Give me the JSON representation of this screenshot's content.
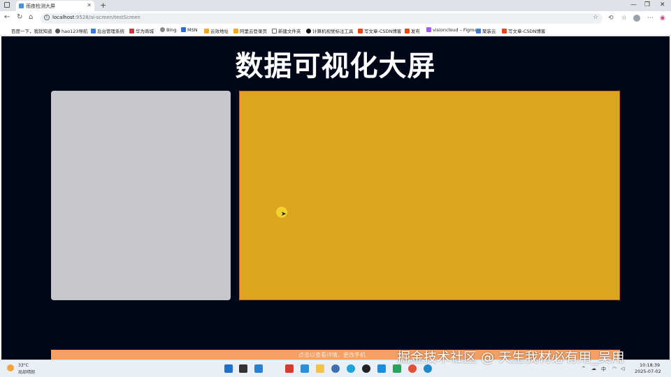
{
  "browser": {
    "tab_title": "雨夜检测大屏",
    "url_host": "localhost",
    "url_rest": ":9528/ai-screen/testScreen"
  },
  "bookmarks": [
    {
      "label": "百度一下，我就知道",
      "icon_color": "#ffffff"
    },
    {
      "label": "hao123导航",
      "icon_color": "#555555"
    },
    {
      "label": "后台管理系统",
      "icon_color": "#3b7bd8"
    },
    {
      "label": "华为商城",
      "icon_color": "#d6303b"
    },
    {
      "label": "Bing",
      "icon_color": "#888888"
    },
    {
      "label": "MSN",
      "icon_color": "#2f6bd1"
    },
    {
      "label": "云效地址",
      "icon_color": "#f5a623"
    },
    {
      "label": "阿里云登录页",
      "icon_color": "#f5a623"
    },
    {
      "label": "新建文件夹",
      "icon_color": "#666666"
    },
    {
      "label": "计算机视觉标注工具",
      "icon_color": "#111111"
    },
    {
      "label": "写文章-CSDN博客",
      "icon_color": "#e8471b"
    },
    {
      "label": "发布",
      "icon_color": "#e8471b"
    },
    {
      "label": "visioncloud – Figma",
      "icon_color": "#a259ff"
    },
    {
      "label": "聚装云",
      "icon_color": "#3b7bd8"
    },
    {
      "label": "写文章-CSDN博客",
      "icon_color": "#e8471b"
    }
  ],
  "page": {
    "title": "数据可视化大屏",
    "bottom_text": "点击以查看详情，更改手机"
  },
  "colors": {
    "background": "#000719",
    "panel_left": "#c7c6cb",
    "panel_right": "#dba520",
    "panel_bottom": "#f2a065"
  },
  "taskbar": {
    "weather_temp": "33°C",
    "weather_desc": "局部晴朗",
    "time": "10:18:39",
    "date": "2025-07-02"
  },
  "watermark": "掘金技术社区 @ 天生我材必有用_吴用"
}
